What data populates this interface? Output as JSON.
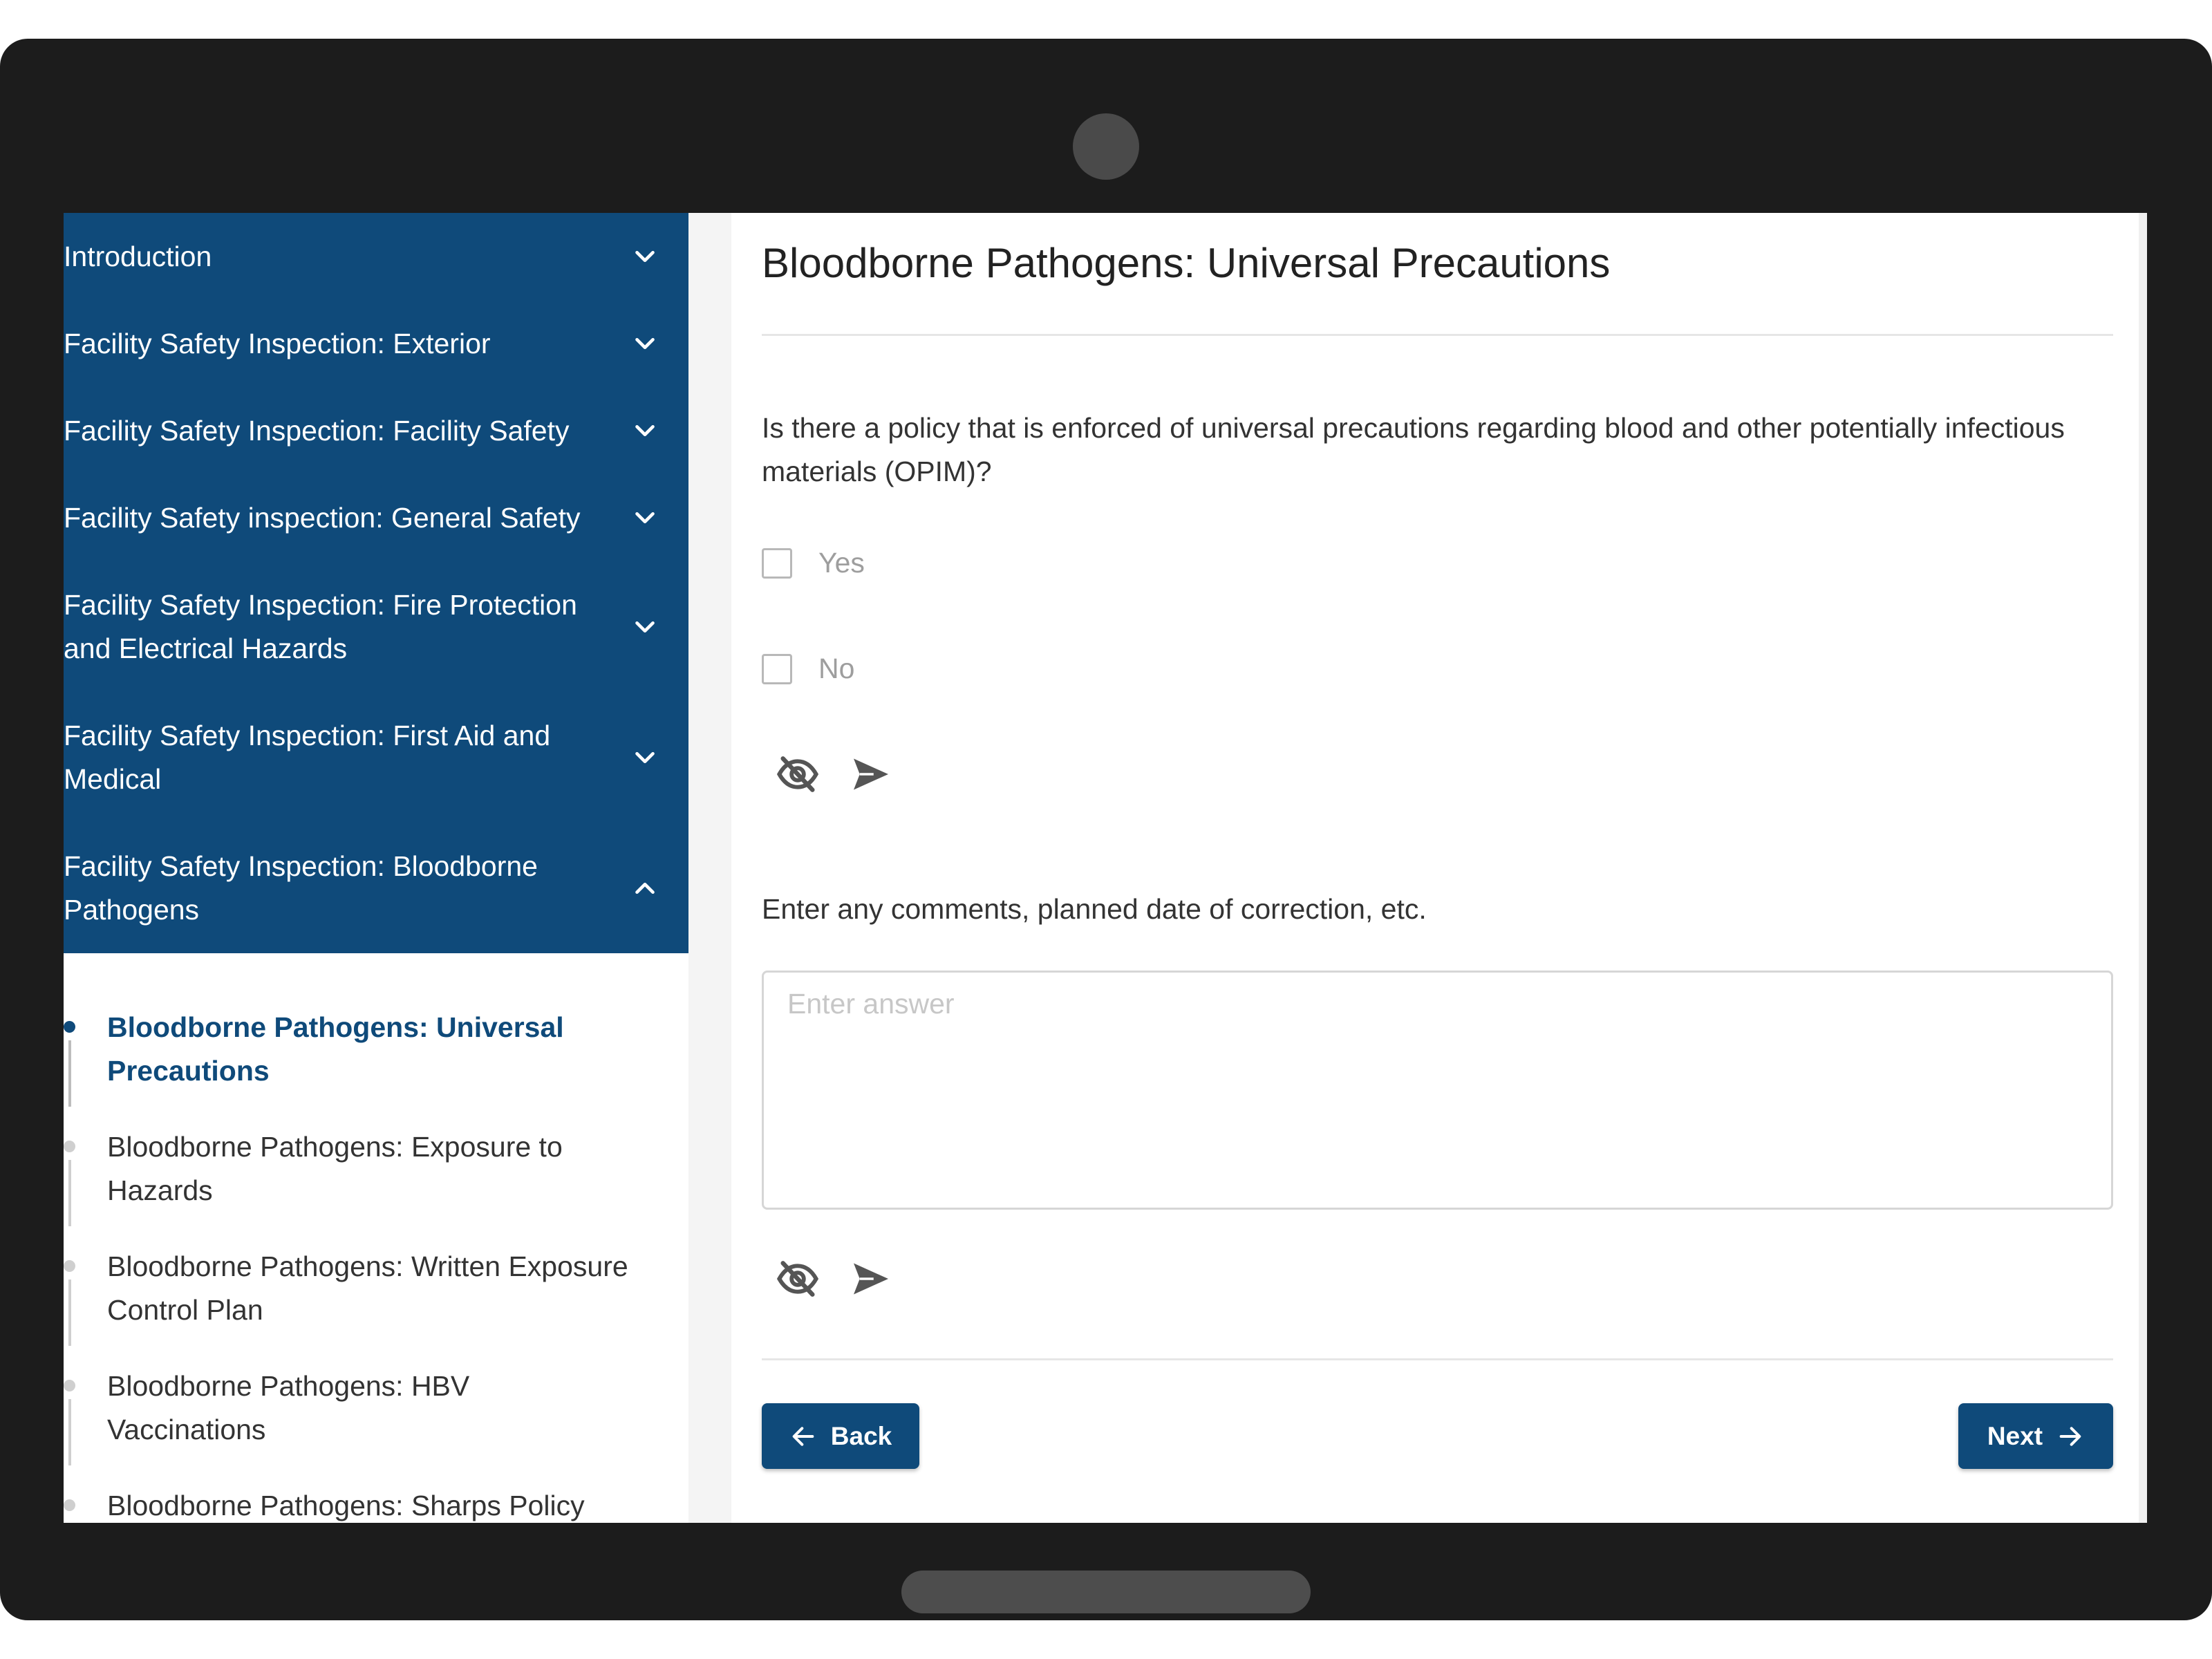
{
  "sidebar": {
    "sections": [
      {
        "label": "Introduction",
        "expanded": false
      },
      {
        "label": "Facility Safety Inspection: Exterior",
        "expanded": false
      },
      {
        "label": "Facility Safety Inspection: Facility Safety",
        "expanded": false
      },
      {
        "label": "Facility Safety inspection: General Safety",
        "expanded": false
      },
      {
        "label": "Facility Safety Inspection: Fire Protection and Electrical Hazards",
        "expanded": false
      },
      {
        "label": "Facility Safety Inspection: First Aid and Medical",
        "expanded": false
      },
      {
        "label": "Facility Safety Inspection: Bloodborne Pathogens",
        "expanded": true
      }
    ],
    "subitems": [
      {
        "label": "Bloodborne Pathogens: Universal Precautions",
        "active": true
      },
      {
        "label": "Bloodborne Pathogens: Exposure to Hazards",
        "active": false
      },
      {
        "label": "Bloodborne Pathogens: Written Exposure Control Plan",
        "active": false
      },
      {
        "label": "Bloodborne Pathogens: HBV Vaccinations",
        "active": false
      },
      {
        "label": "Bloodborne Pathogens: Sharps Policy",
        "active": false
      }
    ]
  },
  "main": {
    "title": "Bloodborne Pathogens: Universal Precautions",
    "question": "Is there a policy that is enforced of universal precautions regarding blood and other potentially infectious materials (OPIM)?",
    "options": [
      {
        "label": "Yes",
        "checked": false
      },
      {
        "label": "No",
        "checked": false
      }
    ],
    "comment_label": "Enter any comments, planned date of correction, etc.",
    "comment_placeholder": "Enter answer",
    "comment_value": "",
    "back_label": "Back",
    "next_label": "Next"
  },
  "icons": {
    "hide": "eye-off-icon",
    "send": "send-icon",
    "expand": "chevron-down-icon",
    "collapse": "chevron-up-icon",
    "back": "arrow-left-icon",
    "next": "arrow-right-icon"
  },
  "colors": {
    "primary": "#0f4a7a",
    "sidebar_text": "#ffffff",
    "device_bezel": "#1c1c1c"
  }
}
